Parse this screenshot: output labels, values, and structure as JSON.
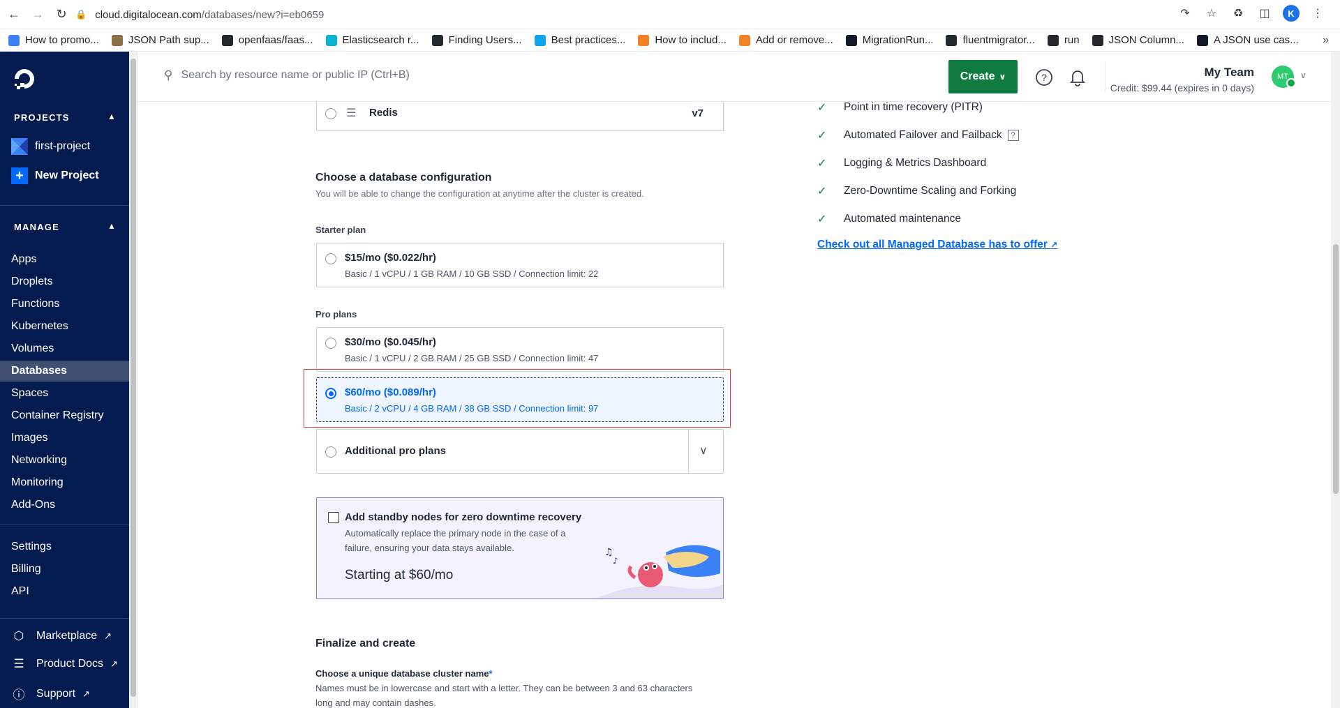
{
  "browser": {
    "url_host": "cloud.digitalocean.com",
    "url_path": "/databases/new?i=eb0659",
    "profile_initial": "K",
    "bookmarks": [
      {
        "label": "How to promo...",
        "color": "#3b82f6"
      },
      {
        "label": "JSON Path sup...",
        "color": "#8b6f47"
      },
      {
        "label": "openfaas/faas...",
        "color": "#24292f"
      },
      {
        "label": "Elasticsearch r...",
        "color": "#06b6d4"
      },
      {
        "label": "Finding Users...",
        "color": "#24292f"
      },
      {
        "label": "Best practices...",
        "color": "#0ea5e9"
      },
      {
        "label": "How to includ...",
        "color": "#f48024"
      },
      {
        "label": "Add or remove...",
        "color": "#f48024"
      },
      {
        "label": "MigrationRun...",
        "color": "#111827"
      },
      {
        "label": "fluentmigrator...",
        "color": "#24292f"
      },
      {
        "label": "run",
        "color": "#24292f"
      },
      {
        "label": "JSON Column...",
        "color": "#24292f"
      },
      {
        "label": "A JSON use cas...",
        "color": "#111827"
      }
    ]
  },
  "sidebar": {
    "projects_title": "PROJECTS",
    "projects": [
      {
        "label": "first-project"
      },
      {
        "label": "New Project"
      }
    ],
    "manage_title": "MANAGE",
    "manage_items": [
      "Apps",
      "Droplets",
      "Functions",
      "Kubernetes",
      "Volumes",
      "Databases",
      "Spaces",
      "Container Registry",
      "Images",
      "Networking",
      "Monitoring",
      "Add-Ons"
    ],
    "active_item": "Databases",
    "account_items": [
      "Settings",
      "Billing",
      "API"
    ],
    "footer_items": [
      "Marketplace",
      "Product Docs",
      "Support"
    ]
  },
  "topbar": {
    "search_placeholder": "Search by resource name or public IP (Ctrl+B)",
    "create_label": "Create",
    "team_name": "My Team",
    "credit": "Credit: $99.44 (expires in 0 days)",
    "avatar_initials": "MT"
  },
  "engine": {
    "name": "Redis",
    "version": "v7"
  },
  "config": {
    "title": "Choose a database configuration",
    "subtitle": "You will be able to change the configuration at anytime after the cluster is created.",
    "starter_label": "Starter plan",
    "starter": {
      "price": "$15/mo ($0.022/hr)",
      "spec": "Basic / 1 vCPU / 1 GB RAM / 10 GB SSD / Connection limit: 22"
    },
    "pro_label": "Pro plans",
    "pro": [
      {
        "price": "$30/mo ($0.045/hr)",
        "spec": "Basic / 1 vCPU / 2 GB RAM / 25 GB SSD / Connection limit: 47"
      },
      {
        "price": "$60/mo ($0.089/hr)",
        "spec": "Basic / 2 vCPU / 4 GB RAM / 38 GB SSD / Connection limit: 97"
      }
    ],
    "additional_label": "Additional pro plans"
  },
  "standby": {
    "title": "Add standby nodes for zero downtime recovery",
    "desc_line1": "Automatically replace the primary node in the case of a",
    "desc_line2": "failure, ensuring your data stays available.",
    "price": "Starting at $60/mo"
  },
  "finalize": {
    "title": "Finalize and create",
    "name_label": "Choose a unique database cluster name",
    "required_mark": "*",
    "name_help_line1": "Names must be in lowercase and start with a letter. They can be between 3 and 63 characters",
    "name_help_line2": "long and may contain dashes."
  },
  "features": [
    "Point in time recovery (PITR)",
    "Automated Failover and Failback",
    "Logging & Metrics Dashboard",
    "Zero-Downtime Scaling and Forking",
    "Automated maintenance"
  ],
  "features_help": "?",
  "offer_link": "Check out all Managed Database has to offer",
  "colors": {
    "sidebar_bg": "#031b4e",
    "accent_blue": "#0069ff",
    "create_green": "#0f7b3f",
    "highlight_red": "#e53935"
  }
}
